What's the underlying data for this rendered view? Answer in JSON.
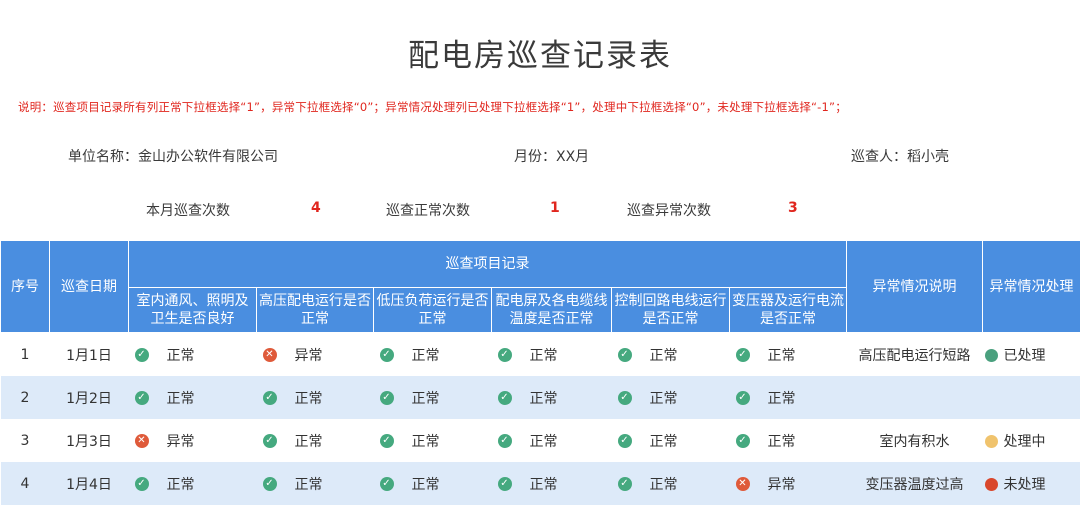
{
  "title": "配电房巡查记录表",
  "note": "说明：巡查项目记录所有列正常下拉框选择“1”，异常下拉框选择“0”；异常情况处理列已处理下拉框选择“1”，处理中下拉框选择“0”，未处理下拉框选择“-1”；",
  "info": {
    "unit": "单位名称：金山办公软件有限公司",
    "month": "月份：XX月",
    "inspector": "巡查人：稻小壳"
  },
  "stats": {
    "total_label": "本月巡查次数",
    "total_value": "4",
    "normal_label": "巡查正常次数",
    "normal_value": "1",
    "abnormal_label": "巡查异常次数",
    "abnormal_value": "3"
  },
  "headers": {
    "seq": "序号",
    "date": "巡查日期",
    "group": "巡查项目记录",
    "items": [
      "室内通风、照明及卫生是否良好",
      "高压配电运行是否正常",
      "低压负荷运行是否正常",
      "配电屏及各电缆线温度是否正常",
      "控制回路电线运行是否正常",
      "变压器及运行电流是否正常"
    ],
    "abnormal_desc": "异常情况说明",
    "handling": "异常情况处理"
  },
  "colors": {
    "header_bg": "#4a8ee0",
    "stripe": "#ddeaf9",
    "ok": "#45a97f",
    "bad": "#df5a3a",
    "done": "#4aa07e",
    "in_progress": "#f0c36d",
    "pending": "#d9472c",
    "accent_red": "#e0261e"
  },
  "rows": [
    {
      "seq": "1",
      "date": "1月1日",
      "checks": [
        {
          "status": "ok",
          "text": "正常"
        },
        {
          "status": "bad",
          "text": "异常"
        },
        {
          "status": "ok",
          "text": "正常"
        },
        {
          "status": "ok",
          "text": "正常"
        },
        {
          "status": "ok",
          "text": "正常"
        },
        {
          "status": "ok",
          "text": "正常"
        }
      ],
      "abnormal": "高压配电运行短路",
      "handling": {
        "state": "done",
        "text": "已处理"
      }
    },
    {
      "seq": "2",
      "date": "1月2日",
      "checks": [
        {
          "status": "ok",
          "text": "正常"
        },
        {
          "status": "ok",
          "text": "正常"
        },
        {
          "status": "ok",
          "text": "正常"
        },
        {
          "status": "ok",
          "text": "正常"
        },
        {
          "status": "ok",
          "text": "正常"
        },
        {
          "status": "ok",
          "text": "正常"
        }
      ],
      "abnormal": "",
      "handling": {
        "state": "",
        "text": ""
      }
    },
    {
      "seq": "3",
      "date": "1月3日",
      "checks": [
        {
          "status": "bad",
          "text": "异常"
        },
        {
          "status": "ok",
          "text": "正常"
        },
        {
          "status": "ok",
          "text": "正常"
        },
        {
          "status": "ok",
          "text": "正常"
        },
        {
          "status": "ok",
          "text": "正常"
        },
        {
          "status": "ok",
          "text": "正常"
        }
      ],
      "abnormal": "室内有积水",
      "handling": {
        "state": "in_progress",
        "text": "处理中"
      }
    },
    {
      "seq": "4",
      "date": "1月4日",
      "checks": [
        {
          "status": "ok",
          "text": "正常"
        },
        {
          "status": "ok",
          "text": "正常"
        },
        {
          "status": "ok",
          "text": "正常"
        },
        {
          "status": "ok",
          "text": "正常"
        },
        {
          "status": "ok",
          "text": "正常"
        },
        {
          "status": "bad",
          "text": "异常"
        }
      ],
      "abnormal": "变压器温度过高",
      "handling": {
        "state": "pending",
        "text": "未处理"
      }
    }
  ]
}
